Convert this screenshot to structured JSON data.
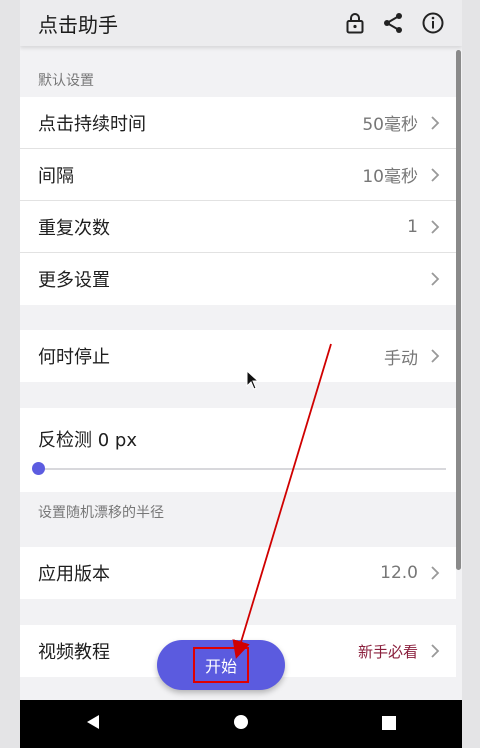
{
  "app": {
    "title": "点击助手"
  },
  "appbar": {
    "icons": [
      "lock-icon",
      "share-icon",
      "info-icon"
    ]
  },
  "sections": {
    "default_settings_label": "默认设置",
    "drift_caption": "设置随机漂移的半径"
  },
  "settings": [
    {
      "label": "点击持续时间",
      "value": "50毫秒"
    },
    {
      "label": "间隔",
      "value": "10毫秒"
    },
    {
      "label": "重复次数",
      "value": "1"
    },
    {
      "label": "更多设置",
      "value": ""
    }
  ],
  "stop": {
    "label": "何时停止",
    "value": "手动"
  },
  "anti_detect": {
    "label": "反检测 0 px",
    "slider_value": 0
  },
  "version": {
    "label": "应用版本",
    "value": "12.0"
  },
  "tutorial": {
    "label": "视频教程",
    "value": "新手必看"
  },
  "fab": {
    "label": "开始"
  },
  "colors": {
    "accent": "#5b5bdf",
    "highlight_box": "#e00000",
    "annotation_arrow": "#d00000",
    "tutorial_value": "#8a1f3c"
  }
}
